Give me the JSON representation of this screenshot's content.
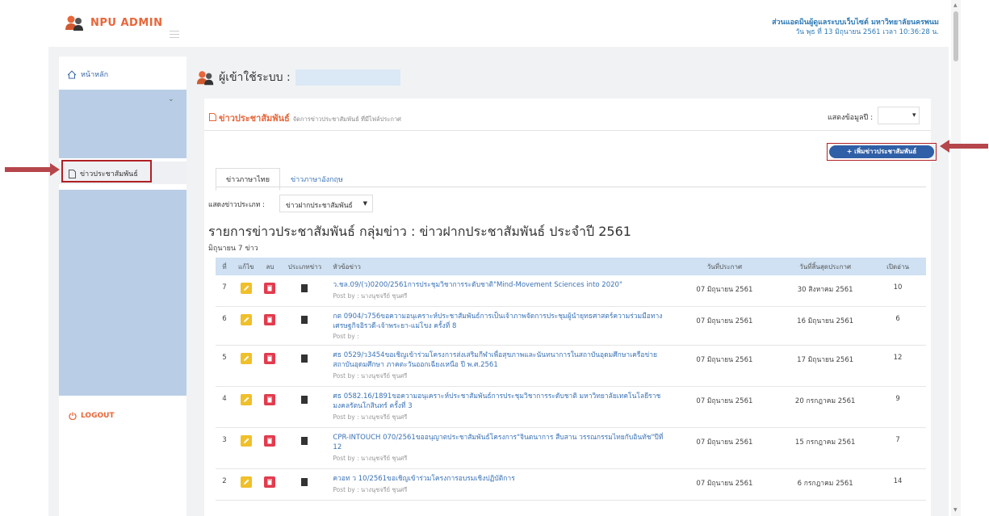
{
  "app": {
    "logo_text": "NPU  ADMIN"
  },
  "header": {
    "org": "ส่วนแอดมินผู้ดูแลระบบเว็บไซต์ มหาวิทยาลัยนครพนม",
    "datetime": "วัน พุธ ที่ 13 มิถุนายน 2561   เวลา 10:36:28  น."
  },
  "sidebar": {
    "home": "หน้าหลัก",
    "news": "ข่าวประชาสัมพันธ์",
    "logout": "LOGOUT"
  },
  "user_bar": {
    "label": "ผู้เข้าใช้ระบบ :"
  },
  "panel": {
    "title": "ข่าวประชาสัมพันธ์",
    "subtitle": "จัดการข่าวประชาสัมพันธ์ ที่มีไฟล์ประกาศ",
    "year_label": "แสดงข้อมูลปี :",
    "add_button": "+ เพิ่มข่าวประชาสัมพันธ์",
    "tabs": [
      "ข่าวภาษาไทย",
      "ข่าวภาษาอังกฤษ"
    ],
    "category_label": "แสดงข่าวประเภท :",
    "category_value": "ข่าวฝากประชาสัมพันธ์",
    "list_title": "รายการข่าวประชาสัมพันธ์ กลุ่มข่าว : ข่าวฝากประชาสัมพันธ์ ประจำปี 2561",
    "list_sub": "มิถุนายน 7 ข่าว"
  },
  "table": {
    "headers": [
      "ที่",
      "แก้ไข",
      "ลบ",
      "ประเภทข่าว",
      "หัวข้อข่าว",
      "วันที่ประกาศ",
      "วันที่สิ้นสุดประกาศ",
      "เปิดอ่าน"
    ],
    "rows": [
      {
        "no": "7",
        "title": "ว.ชล.09/(ว)0200/2561การประชุมวิชาการระดับชาติ\"Mind-Movement Sciences into 2020\"",
        "post": "Post by : นางนุชจรีย์ ชุนศรี",
        "date": "07 มิถุนายน 2561",
        "end": "30 สิงหาคม 2561",
        "views": "10"
      },
      {
        "no": "6",
        "title": "กต 0904/ว756ขอความอนุเคราะห์ประชาสัมพันธ์การเป็นเจ้าภาพจัดการประชุมผู้นำยุทธศาสตร์ความร่วมมือทางเศรษฐกิจอิรวดี-เจ้าพระยา-แม่โขง ครั้งที่ 8",
        "post": "Post by :",
        "date": "07 มิถุนายน 2561",
        "end": "16 มิถุนายน 2561",
        "views": "6"
      },
      {
        "no": "5",
        "title": "ศธ 0529/ว3454ขอเชิญเข้าร่วมโครงการส่งเสริมกีฬาเพื่อสุขภาพและนันทนาการในสถาบันอุดมศึกษาเครือข่ายสถาบันอุดมศึกษา ภาคตะวันออกเฉียงเหนือ ปี พ.ศ.2561",
        "post": "Post by : นางนุชจรีย์ ชุนศรี",
        "date": "07 มิถุนายน 2561",
        "end": "17 มิถุนายน 2561",
        "views": "12"
      },
      {
        "no": "4",
        "title": "ศธ 0582.16/1891ขอความอนุเคราะห์ประชาสัมพันธ์การประชุมวิชาการระดับชาติ มหาวิทยาลัยเทคโนโลยีราชมงคลรัตนโกสินทร์ ครั้งที่ 3",
        "post": "Post by : นางนุชจรีย์ ชุนศรี",
        "date": "07 มิถุนายน 2561",
        "end": "20 กรกฎาคม 2561",
        "views": "9"
      },
      {
        "no": "3",
        "title": "CPR-INTOUCH 070/2561ขออนุญาตประชาสัมพันธ์โครงการ\"จินตนาการ สืบสาน วรรณกรรมไทยกับอินทัช\"ปีที่ 12",
        "post": "Post by : นางนุชจรีย์ ชุนศรี",
        "date": "07 มิถุนายน 2561",
        "end": "15 กรกฎาคม 2561",
        "views": "7"
      },
      {
        "no": "2",
        "title": "ควอท ว 10/2561ขอเชิญเข้าร่วมโครงการอบรมเชิงปฏิบัติการ",
        "post": "Post by : นางนุชจรีย์ ชุนศรี",
        "date": "07 มิถุนายน 2561",
        "end": "6 กรกฎาคม 2561",
        "views": "14"
      }
    ]
  }
}
